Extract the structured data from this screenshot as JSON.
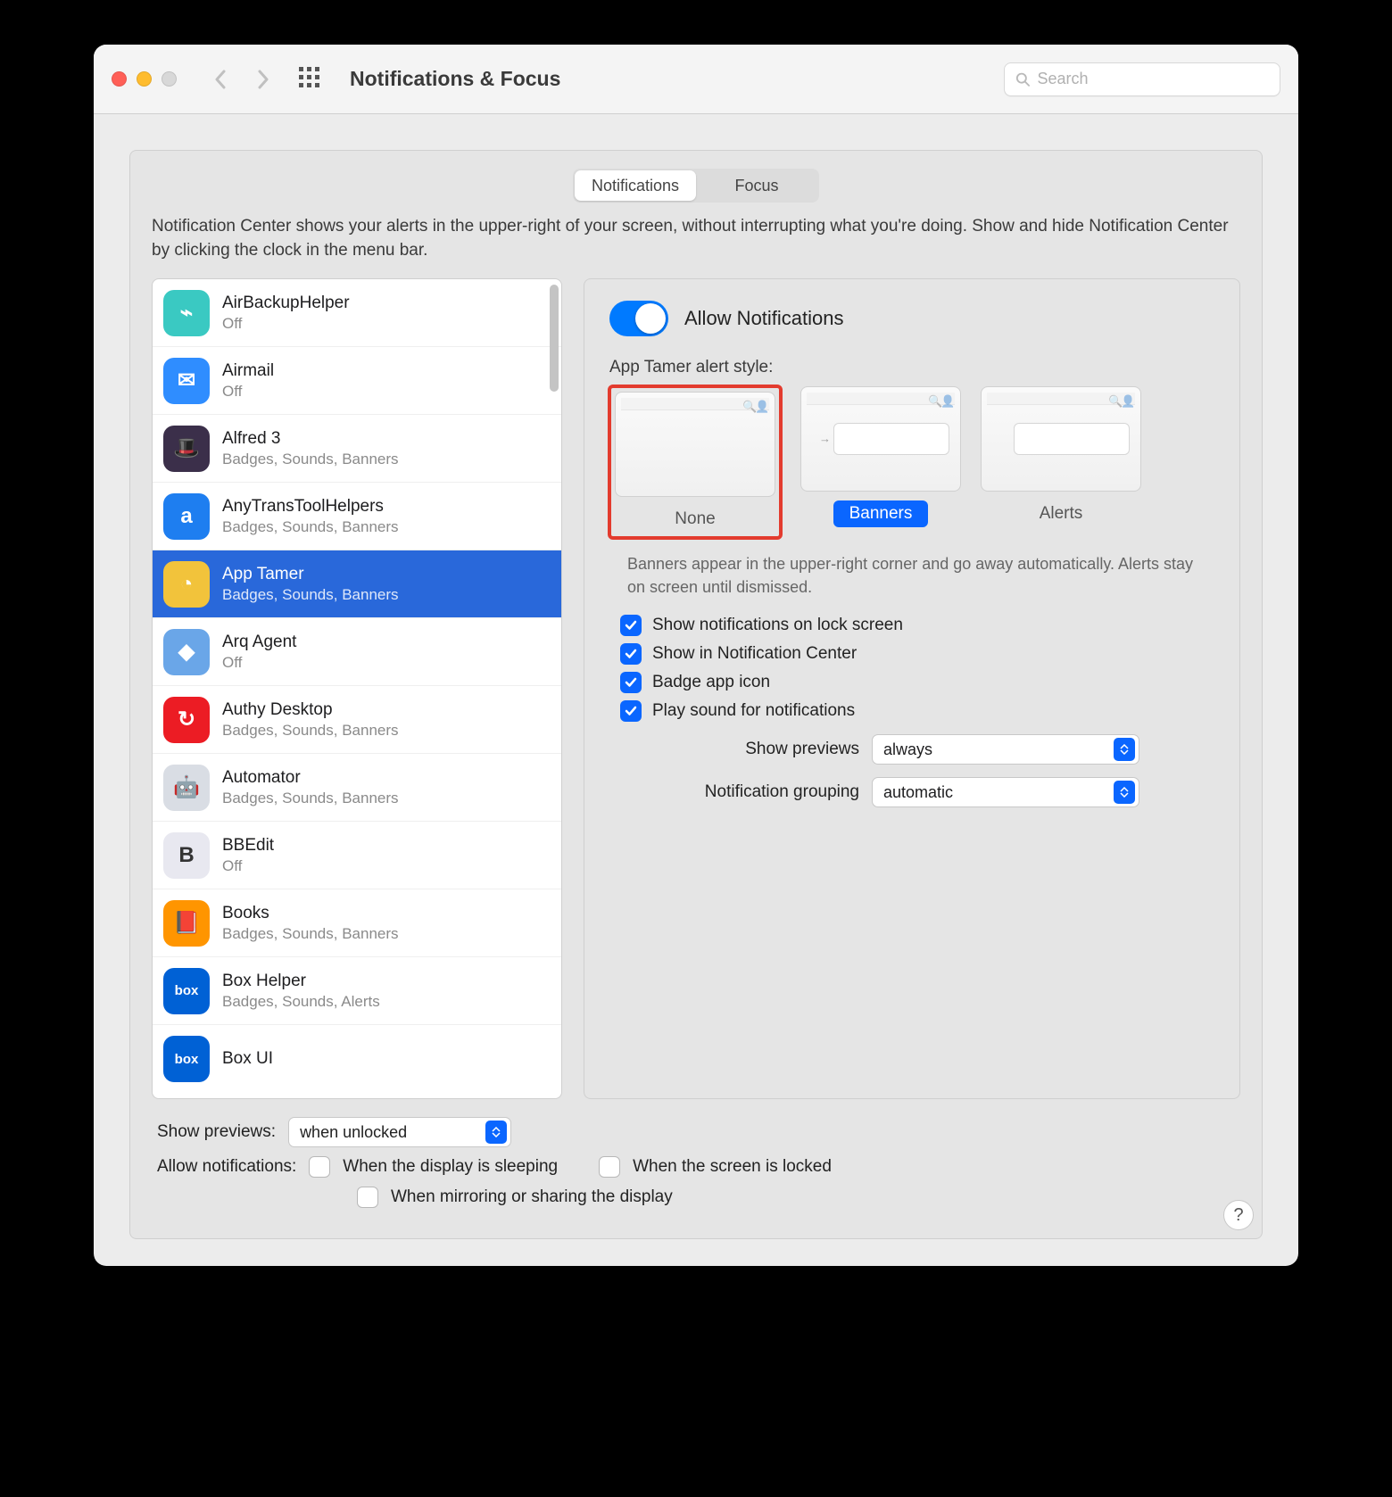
{
  "window_title": "Notifications & Focus",
  "search_placeholder": "Search",
  "tabs": {
    "notifications": "Notifications",
    "focus": "Focus"
  },
  "description": "Notification Center shows your alerts in the upper-right of your screen, without interrupting what you're doing. Show and hide Notification Center by clicking the clock in the menu bar.",
  "apps": [
    {
      "name": "AirBackupHelper",
      "sub": "Off",
      "icon_bg": "#3ac9c2",
      "icon_txt": "⌁"
    },
    {
      "name": "Airmail",
      "sub": "Off",
      "icon_bg": "#2f8dff",
      "icon_txt": "✉"
    },
    {
      "name": "Alfred 3",
      "sub": "Badges, Sounds, Banners",
      "icon_bg": "#3b2f4a",
      "icon_txt": "🎩"
    },
    {
      "name": "AnyTransToolHelpers",
      "sub": "Badges, Sounds, Banners",
      "icon_bg": "#1e7ef0",
      "icon_txt": "a"
    },
    {
      "name": "App Tamer",
      "sub": "Badges, Sounds, Banners",
      "icon_bg": "#f2c33b",
      "icon_txt": "◔",
      "selected": true
    },
    {
      "name": "Arq Agent",
      "sub": "Off",
      "icon_bg": "#6aa6e8",
      "icon_txt": "◆"
    },
    {
      "name": "Authy Desktop",
      "sub": "Badges, Sounds, Banners",
      "icon_bg": "#ec1c24",
      "icon_txt": "↻"
    },
    {
      "name": "Automator",
      "sub": "Badges, Sounds, Banners",
      "icon_bg": "#d9dde4",
      "icon_txt": "🤖"
    },
    {
      "name": "BBEdit",
      "sub": "Off",
      "icon_bg": "#e8e8f0",
      "icon_txt": "B"
    },
    {
      "name": "Books",
      "sub": "Badges, Sounds, Banners",
      "icon_bg": "#ff9500",
      "icon_txt": "📕"
    },
    {
      "name": "Box Helper",
      "sub": "Badges, Sounds, Alerts",
      "icon_bg": "#0061d5",
      "icon_txt": "box"
    },
    {
      "name": "Box UI",
      "sub": "",
      "icon_bg": "#0061d5",
      "icon_txt": "box"
    }
  ],
  "detail": {
    "allow_label": "Allow Notifications",
    "alert_style_label": "App Tamer alert style:",
    "styles": {
      "none": "None",
      "banners": "Banners",
      "alerts": "Alerts"
    },
    "style_desc": "Banners appear in the upper-right corner and go away automatically. Alerts stay on screen until dismissed.",
    "checks": {
      "lock": "Show notifications on lock screen",
      "center": "Show in Notification Center",
      "badge": "Badge app icon",
      "sound": "Play sound for notifications"
    },
    "dropdowns": {
      "previews_label": "Show previews",
      "previews_value": "always",
      "grouping_label": "Notification grouping",
      "grouping_value": "automatic"
    }
  },
  "bottom": {
    "show_previews_label": "Show previews:",
    "show_previews_value": "when unlocked",
    "allow_label": "Allow notifications:",
    "opt_sleeping": "When the display is sleeping",
    "opt_locked": "When the screen is locked",
    "opt_mirroring": "When mirroring or sharing the display"
  },
  "help": "?"
}
